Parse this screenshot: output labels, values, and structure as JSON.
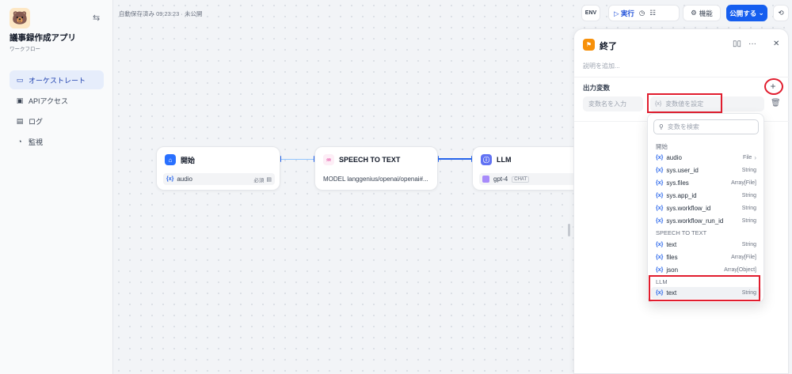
{
  "app": {
    "name": "議事録作成アプリ",
    "type": "ワークフロー",
    "icon": "bear-icon"
  },
  "nav": [
    {
      "label": "オーケストレート",
      "icon": "layout-icon",
      "active": true
    },
    {
      "label": "APIアクセス",
      "icon": "terminal-icon",
      "active": false
    },
    {
      "label": "ログ",
      "icon": "document-icon",
      "active": false
    },
    {
      "label": "監視",
      "icon": "gauge-icon",
      "active": false
    }
  ],
  "status": {
    "autosave": "自動保存済み 09:23:23 · 未公開"
  },
  "toolbar": {
    "env_label": "ENV",
    "run_label": "実行",
    "features_label": "機能",
    "publish_label": "公開する"
  },
  "nodes": [
    {
      "title": "開始",
      "var_tag": "{x}",
      "var_name": "audio",
      "required": "必須"
    },
    {
      "title": "SPEECH TO TEXT",
      "model_text": "MODEL langgenius/openai/openai#..."
    },
    {
      "title": "LLM",
      "model": "gpt-4",
      "mode": "CHAT"
    }
  ],
  "panel": {
    "title": "終了",
    "description_placeholder": "説明を追加...",
    "output_vars_label": "出力変数",
    "var_name_placeholder": "変数名を入力",
    "var_value_placeholder": "変数値を設定",
    "var_tag": "{x}"
  },
  "dropdown": {
    "search_placeholder": "変数を検索",
    "groups": [
      {
        "name": "開始",
        "items": [
          {
            "name": "audio",
            "type": "File"
          },
          {
            "name": "sys.user_id",
            "type": "String"
          },
          {
            "name": "sys.files",
            "type": "Array[File]"
          },
          {
            "name": "sys.app_id",
            "type": "String"
          },
          {
            "name": "sys.workflow_id",
            "type": "String"
          },
          {
            "name": "sys.workflow_run_id",
            "type": "String"
          }
        ]
      },
      {
        "name": "SPEECH TO TEXT",
        "items": [
          {
            "name": "text",
            "type": "String"
          },
          {
            "name": "files",
            "type": "Array[File]"
          },
          {
            "name": "json",
            "type": "Array[Object]"
          }
        ]
      },
      {
        "name": "LLM",
        "items": [
          {
            "name": "text",
            "type": "String"
          }
        ]
      }
    ]
  },
  "colors": {
    "accent": "#155eef",
    "highlight": "#e11d2e",
    "start_node": "#2970ff",
    "stt_node": "#dd2590",
    "llm_node": "#6172f3",
    "end_node": "#f79009"
  }
}
